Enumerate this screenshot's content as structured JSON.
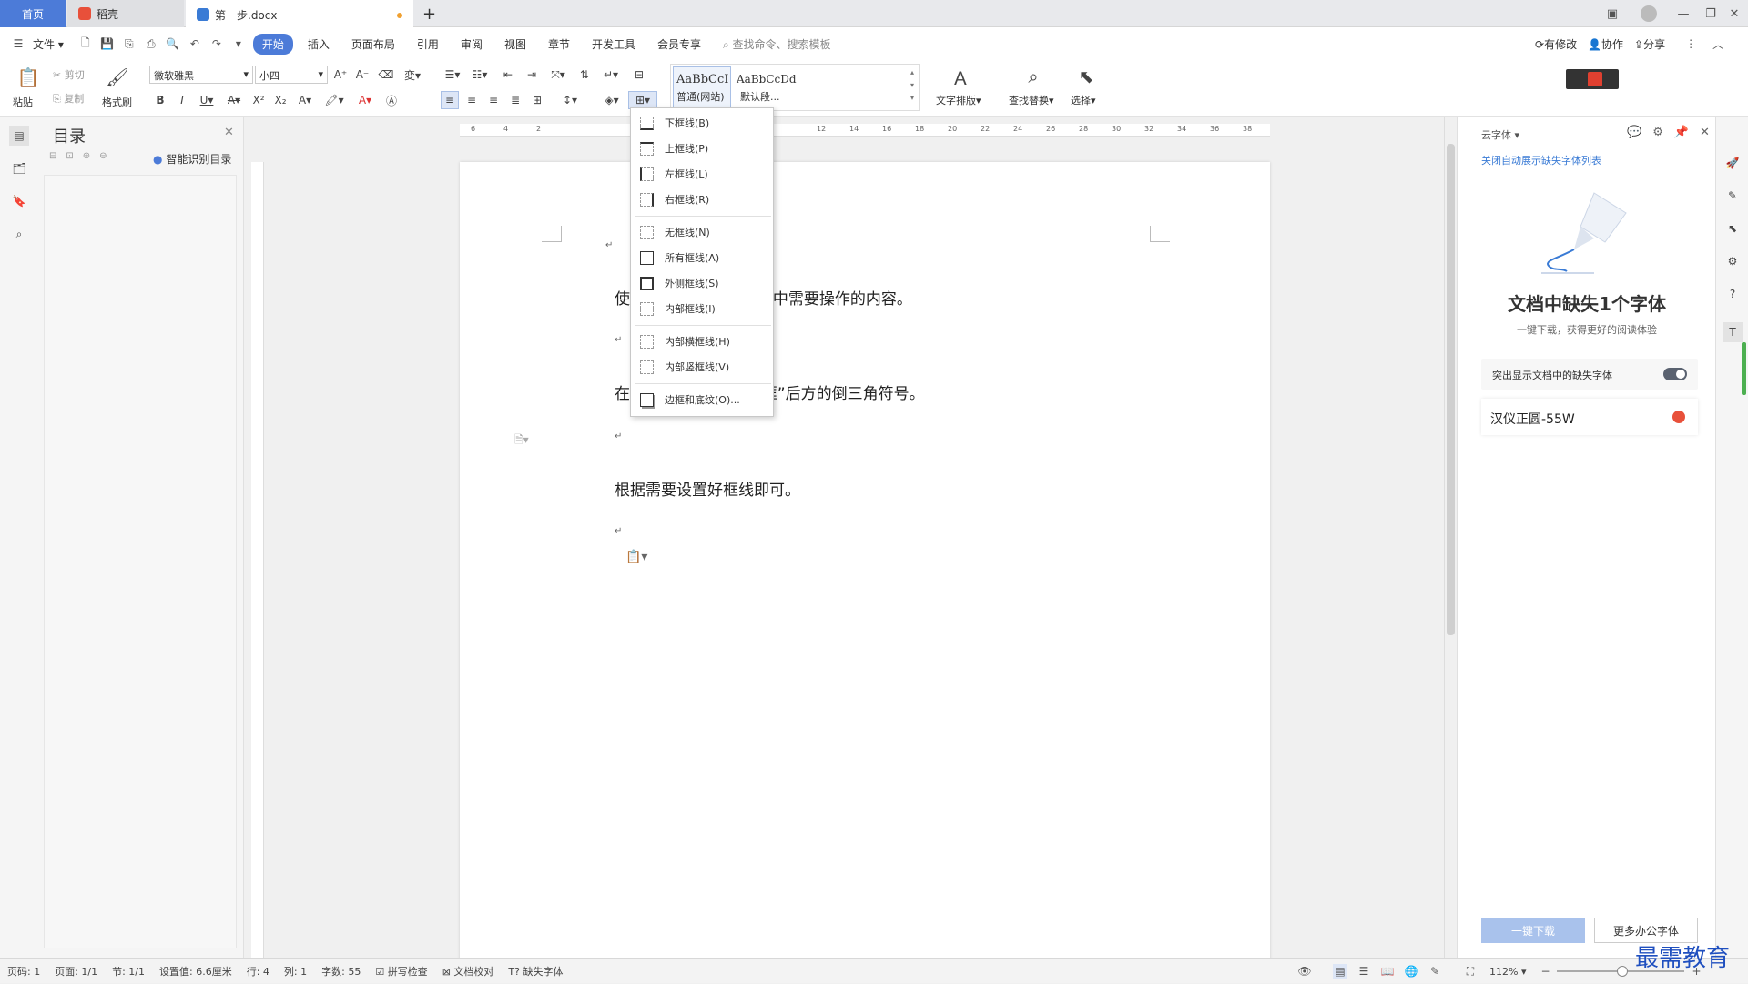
{
  "tabs": {
    "home": "首页",
    "docer": "稻壳",
    "doc": "第一步.docx",
    "add": "+"
  },
  "menu": {
    "file": "文件",
    "items": [
      "开始",
      "插入",
      "页面布局",
      "引用",
      "审阅",
      "视图",
      "章节",
      "开发工具",
      "会员专享"
    ],
    "search": "查找命令、搜索模板",
    "modify": "有修改",
    "collab": "协作",
    "share": "分享"
  },
  "ribbon": {
    "paste": "粘贴",
    "cut": "剪切",
    "copy": "复制",
    "format_painter": "格式刷",
    "font": "微软雅黑",
    "size": "小四",
    "style1_preview": "AaBbCcI",
    "style1": "普通(网站)",
    "style2_preview": "AaBbCcDd",
    "style2": "默认段...",
    "text_layout": "文字排版",
    "find_replace": "查找替换",
    "select": "选择"
  },
  "toc": {
    "title": "目录",
    "smart": "智能识别目录"
  },
  "document": {
    "line1": "使用WPS打开文档，选中需要操作的内容。",
    "line2": "在开始菜单下点击“边框”后方的倒三角符号。",
    "line3": "根据需要设置好框线即可。"
  },
  "dropdown": {
    "items": [
      "下框线(B)",
      "上框线(P)",
      "左框线(L)",
      "右框线(R)",
      "无框线(N)",
      "所有框线(A)",
      "外侧框线(S)",
      "内部框线(I)",
      "内部横框线(H)",
      "内部竖框线(V)",
      "边框和底纹(O)..."
    ]
  },
  "rightpanel": {
    "header": "云字体",
    "close_auto": "关闭自动展示缺失字体列表",
    "title": "文档中缺失1个字体",
    "subtitle": "一键下载，获得更好的阅读体验",
    "toggle_label": "突出显示文档中的缺失字体",
    "font_item": "汉仪正圆-55W",
    "download_btn": "一键下载",
    "more_btn": "更多办公字体"
  },
  "status": {
    "page_num": "页码: 1",
    "pages": "页面: 1/1",
    "section": "节: 1/1",
    "setting": "设置值: 6.6厘米",
    "row": "行: 4",
    "col": "列: 1",
    "words": "字数: 55",
    "spell": "拼写检查",
    "proof": "文档校对",
    "missing_font": "缺失字体",
    "zoom": "112%"
  },
  "watermark": "最需教育",
  "colors": {
    "accent": "#4c7bd8",
    "link": "#3a7bd5"
  }
}
